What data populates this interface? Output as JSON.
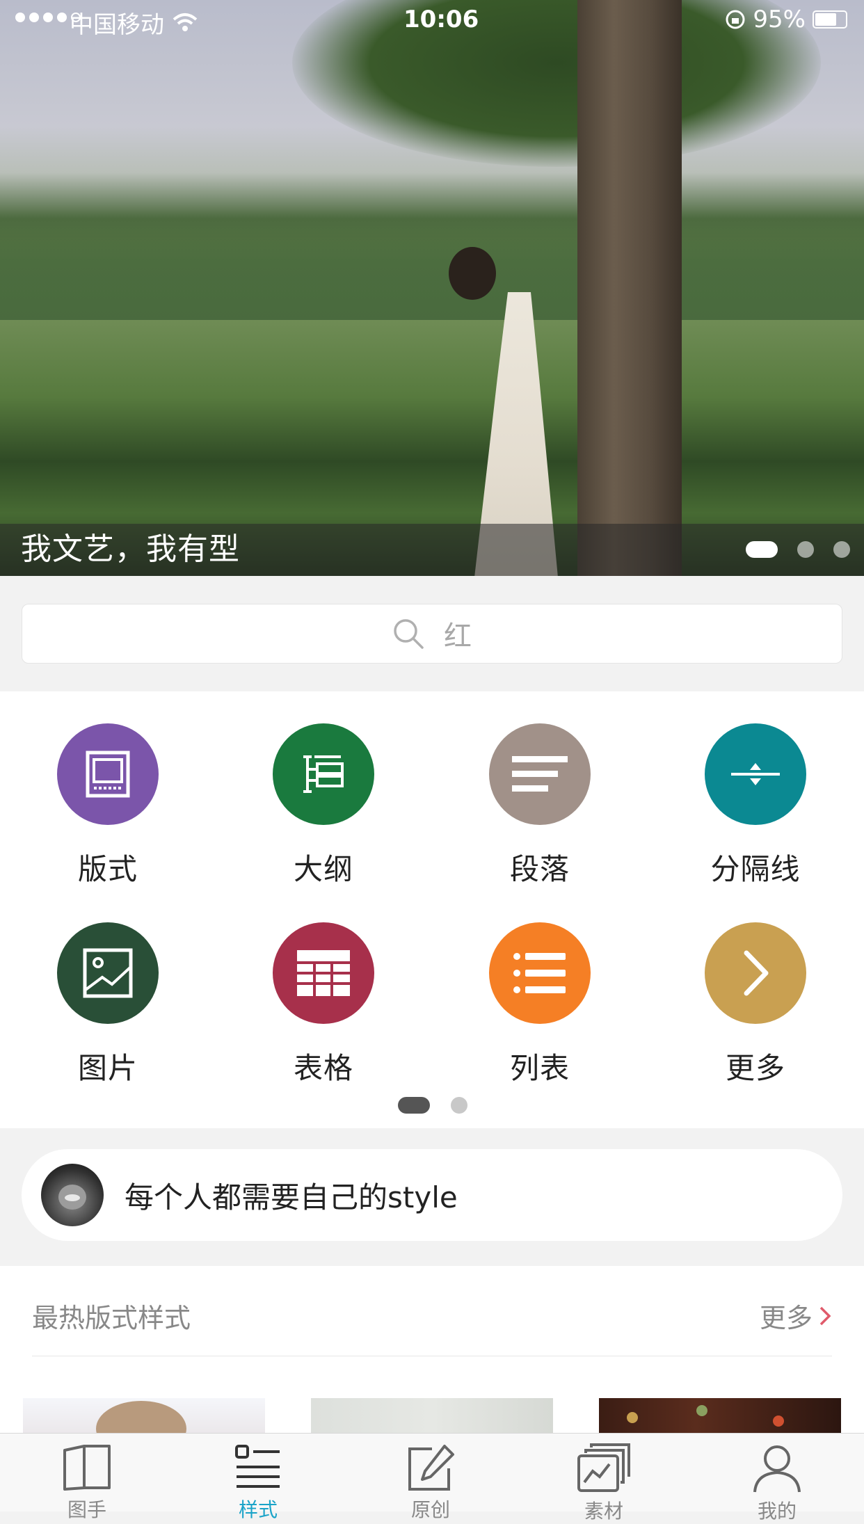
{
  "status_bar": {
    "carrier": "中国移动",
    "time": "10:06",
    "battery": "95%"
  },
  "banner": {
    "caption": "我文艺，我有型",
    "slide_count": 3,
    "active_slide": 1
  },
  "search": {
    "placeholder": "红"
  },
  "categories": [
    {
      "label": "版式",
      "icon": "layout-icon",
      "color": "#7b55aa"
    },
    {
      "label": "大纲",
      "icon": "outline-icon",
      "color": "#1a7a3e"
    },
    {
      "label": "段落",
      "icon": "paragraph-icon",
      "color": "#a19189"
    },
    {
      "label": "分隔线",
      "icon": "divider-icon",
      "color": "#0b8992"
    },
    {
      "label": "图片",
      "icon": "image-icon",
      "color": "#294f37"
    },
    {
      "label": "表格",
      "icon": "table-icon",
      "color": "#a7304b"
    },
    {
      "label": "列表",
      "icon": "list-icon",
      "color": "#f57f25"
    },
    {
      "label": "更多",
      "icon": "chevron-right-icon",
      "color": "#c9a051"
    }
  ],
  "category_pager": {
    "pages": 2,
    "active": 1
  },
  "motto": {
    "text": "每个人都需要自己的style"
  },
  "hot_section": {
    "title": "最热版式样式",
    "more_label": "更多"
  },
  "tab_bar": [
    {
      "label": "图手",
      "icon": "book-icon",
      "active": false
    },
    {
      "label": "样式",
      "icon": "style-list-icon",
      "active": true
    },
    {
      "label": "原创",
      "icon": "edit-icon",
      "active": false
    },
    {
      "label": "素材",
      "icon": "gallery-icon",
      "active": false
    },
    {
      "label": "我的",
      "icon": "user-icon",
      "active": false
    }
  ],
  "colors": {
    "accent": "#1aa3c8",
    "background": "#f2f2f2"
  }
}
